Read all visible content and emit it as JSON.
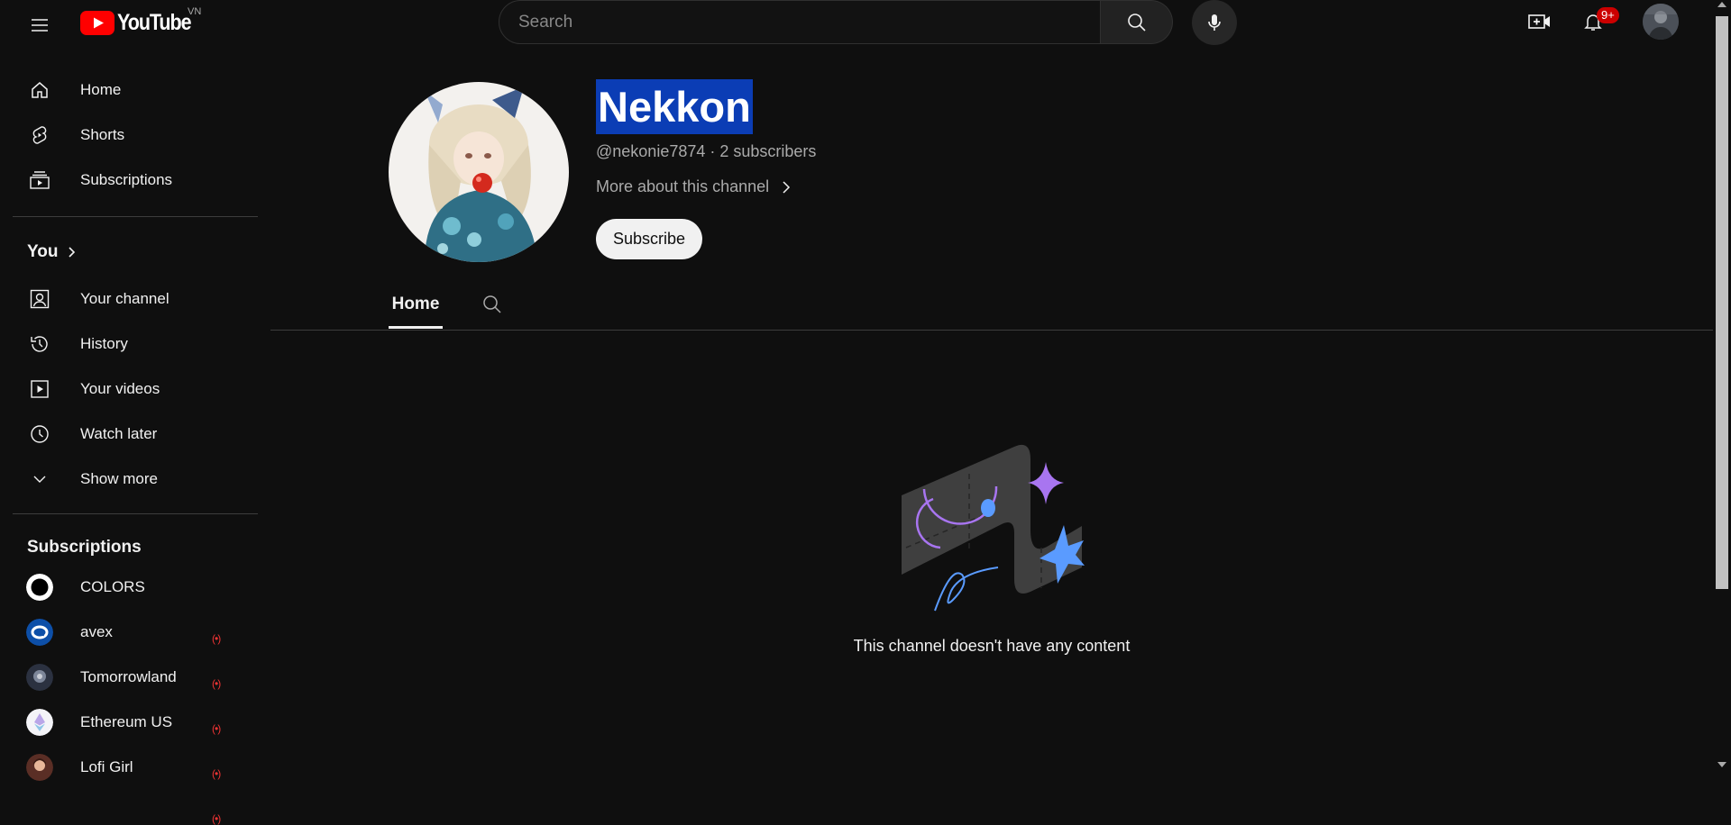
{
  "header": {
    "logo_text": "YouTube",
    "country_code": "VN",
    "search_placeholder": "Search",
    "notification_count": "9+"
  },
  "sidebar": {
    "main": [
      {
        "label": "Home",
        "icon": "home-icon"
      },
      {
        "label": "Shorts",
        "icon": "shorts-icon"
      },
      {
        "label": "Subscriptions",
        "icon": "subscriptions-icon"
      }
    ],
    "you_title": "You",
    "you_items": [
      {
        "label": "Your channel",
        "icon": "your-channel-icon"
      },
      {
        "label": "History",
        "icon": "history-icon"
      },
      {
        "label": "Your videos",
        "icon": "your-videos-icon"
      },
      {
        "label": "Watch later",
        "icon": "watch-later-icon"
      },
      {
        "label": "Show more",
        "icon": "chevron-down-icon"
      }
    ],
    "subscriptions_title": "Subscriptions",
    "subscriptions": [
      {
        "name": "COLORS",
        "live": "(•)"
      },
      {
        "name": "avex",
        "live": "(•)"
      },
      {
        "name": "Tomorrowland",
        "live": "(•)"
      },
      {
        "name": "Ethereum US",
        "live": "(•)"
      },
      {
        "name": "Lofi Girl",
        "live": "(•)"
      }
    ]
  },
  "channel": {
    "name": "Nekkon",
    "meta": "@nekonie7874 · 2 subscribers",
    "about": "More about this channel",
    "subscribe_label": "Subscribe",
    "tabs": [
      {
        "label": "Home"
      }
    ],
    "empty_message": "This channel doesn't have any content"
  },
  "colors": {
    "background": "#0f0f0f",
    "brand_red": "#ff0000",
    "name_highlight": "#0b3db5",
    "illustration_purple": "#a875f0",
    "illustration_blue": "#5a9bff"
  }
}
